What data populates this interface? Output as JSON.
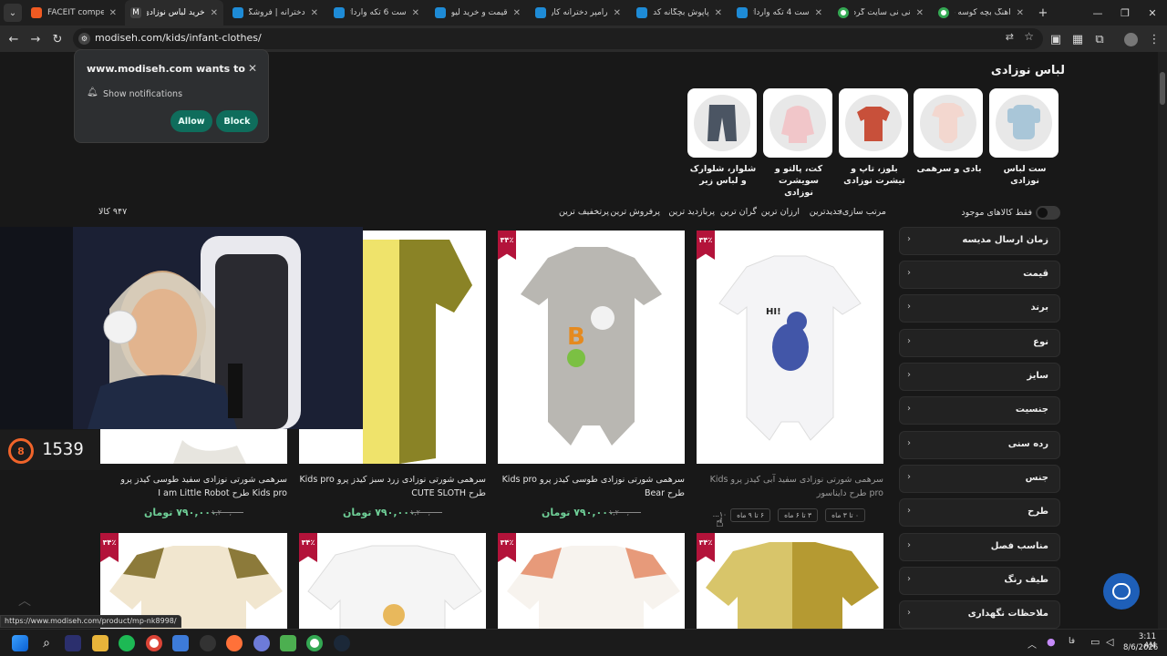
{
  "tabs": [
    {
      "title": "FACEIT competiti...",
      "color": "#f05a22"
    },
    {
      "title": "خرید لباس نوزادی",
      "color": "#555555"
    },
    {
      "title": "دخترانه | فروشگاه ا",
      "color": "#1e8bd6"
    },
    {
      "title": "ست 6 تکه وارداتی",
      "color": "#1e8bd6"
    },
    {
      "title": "قیمت و خرید لیوان",
      "color": "#1e8bd6"
    },
    {
      "title": "رامپر دخترانه کارتر",
      "color": "#1e8bd6"
    },
    {
      "title": "پاپوش بچگانه کد 47",
      "color": "#1e8bd6"
    },
    {
      "title": "ست 4 تکه وارداتی",
      "color": "#1e8bd6"
    },
    {
      "title": "نی نی سایت گردن",
      "color": "#34a853"
    },
    {
      "title": "آهنگ بچه کوسه -",
      "color": "#34a853"
    }
  ],
  "address": {
    "url": "modiseh.com/kids/infant-clothes/"
  },
  "notification": {
    "title": "www.modiseh.com wants to",
    "option": "Show notifications",
    "allow": "Allow",
    "block": "Block"
  },
  "page": {
    "heading": "لباس نوزادی",
    "categories": [
      {
        "label": "ست لباس نوزادی"
      },
      {
        "label": "بادی و سرهمی"
      },
      {
        "label": "بلوز، تاپ و تیشرت نوزادی"
      },
      {
        "label": "کت، پالتو و سویشرت نوزادی"
      },
      {
        "label": "شلوار، شلوارک و لباس زیر"
      }
    ],
    "only_available": "فقط کالاهای موجود",
    "sort_label": "مرتب سازی:",
    "sort_options": [
      "جدیدترین",
      "ارزان ترین",
      "گران ترین",
      "پربازدید ترین",
      "پرفروش ترین",
      "پرتخفیف ترین"
    ],
    "count": "۹۴۷ کالا",
    "filters": [
      "زمان ارسال مدیسه",
      "قیمت",
      "برند",
      "نوع",
      "سایز",
      "جنسیت",
      "رده سنی",
      "جنس",
      "طرح",
      "مناسب فصل",
      "طیف رنگ",
      "ملاحظات نگهداری"
    ],
    "products": [
      {
        "badge": "۳۴٪",
        "name": "سرهمی شورتی نوزادی سفید آبی کیدز پرو Kids pro طرح دایناسور",
        "sizes": [
          "۰ تا ۳ ماه",
          "۳ تا ۶ ماه",
          "۶ تا ۹ ماه",
          "۱۰..."
        ]
      },
      {
        "badge": "۳۴٪",
        "name": "سرهمی شورتی نوزادی طوسی کیدز پرو Kids pro طرح Bear",
        "price": "۷۹۰,۰۰۰ تومان",
        "old": "۱,۲۰۰,۰۰۰"
      },
      {
        "badge": "",
        "name": "سرهمی شورتی نوزادی زرد سبز کیدز پرو Kids pro طرح CUTE SLOTH",
        "price": "۷۹۰,۰۰۰ تومان",
        "old": "۱,۲۰۰,۰۰۰"
      },
      {
        "badge": "",
        "name": "سرهمی شورتی نوزادی سفید طوسی کیدز پرو Kids pro طرح I am Little Robot",
        "price": "۷۹۰,۰۰۰ تومان",
        "old": "۱,۲۰۰,۰۰۰"
      }
    ],
    "row2_badges": [
      "۳۴٪",
      "۳۴٪",
      "۳۴٪",
      "۳۴٪"
    ]
  },
  "overlay": {
    "elo": "1539",
    "level": "8"
  },
  "status_url": "https://www.modiseh.com/product/mp-nk8998/",
  "taskbar": {
    "time": "3:11 AM",
    "date": "8/6/2026",
    "lang": "فا"
  },
  "colors": {
    "accent_green": "#6fcf97",
    "badge_red": "#b3133a",
    "allow_btn": "#0f6d5c"
  }
}
